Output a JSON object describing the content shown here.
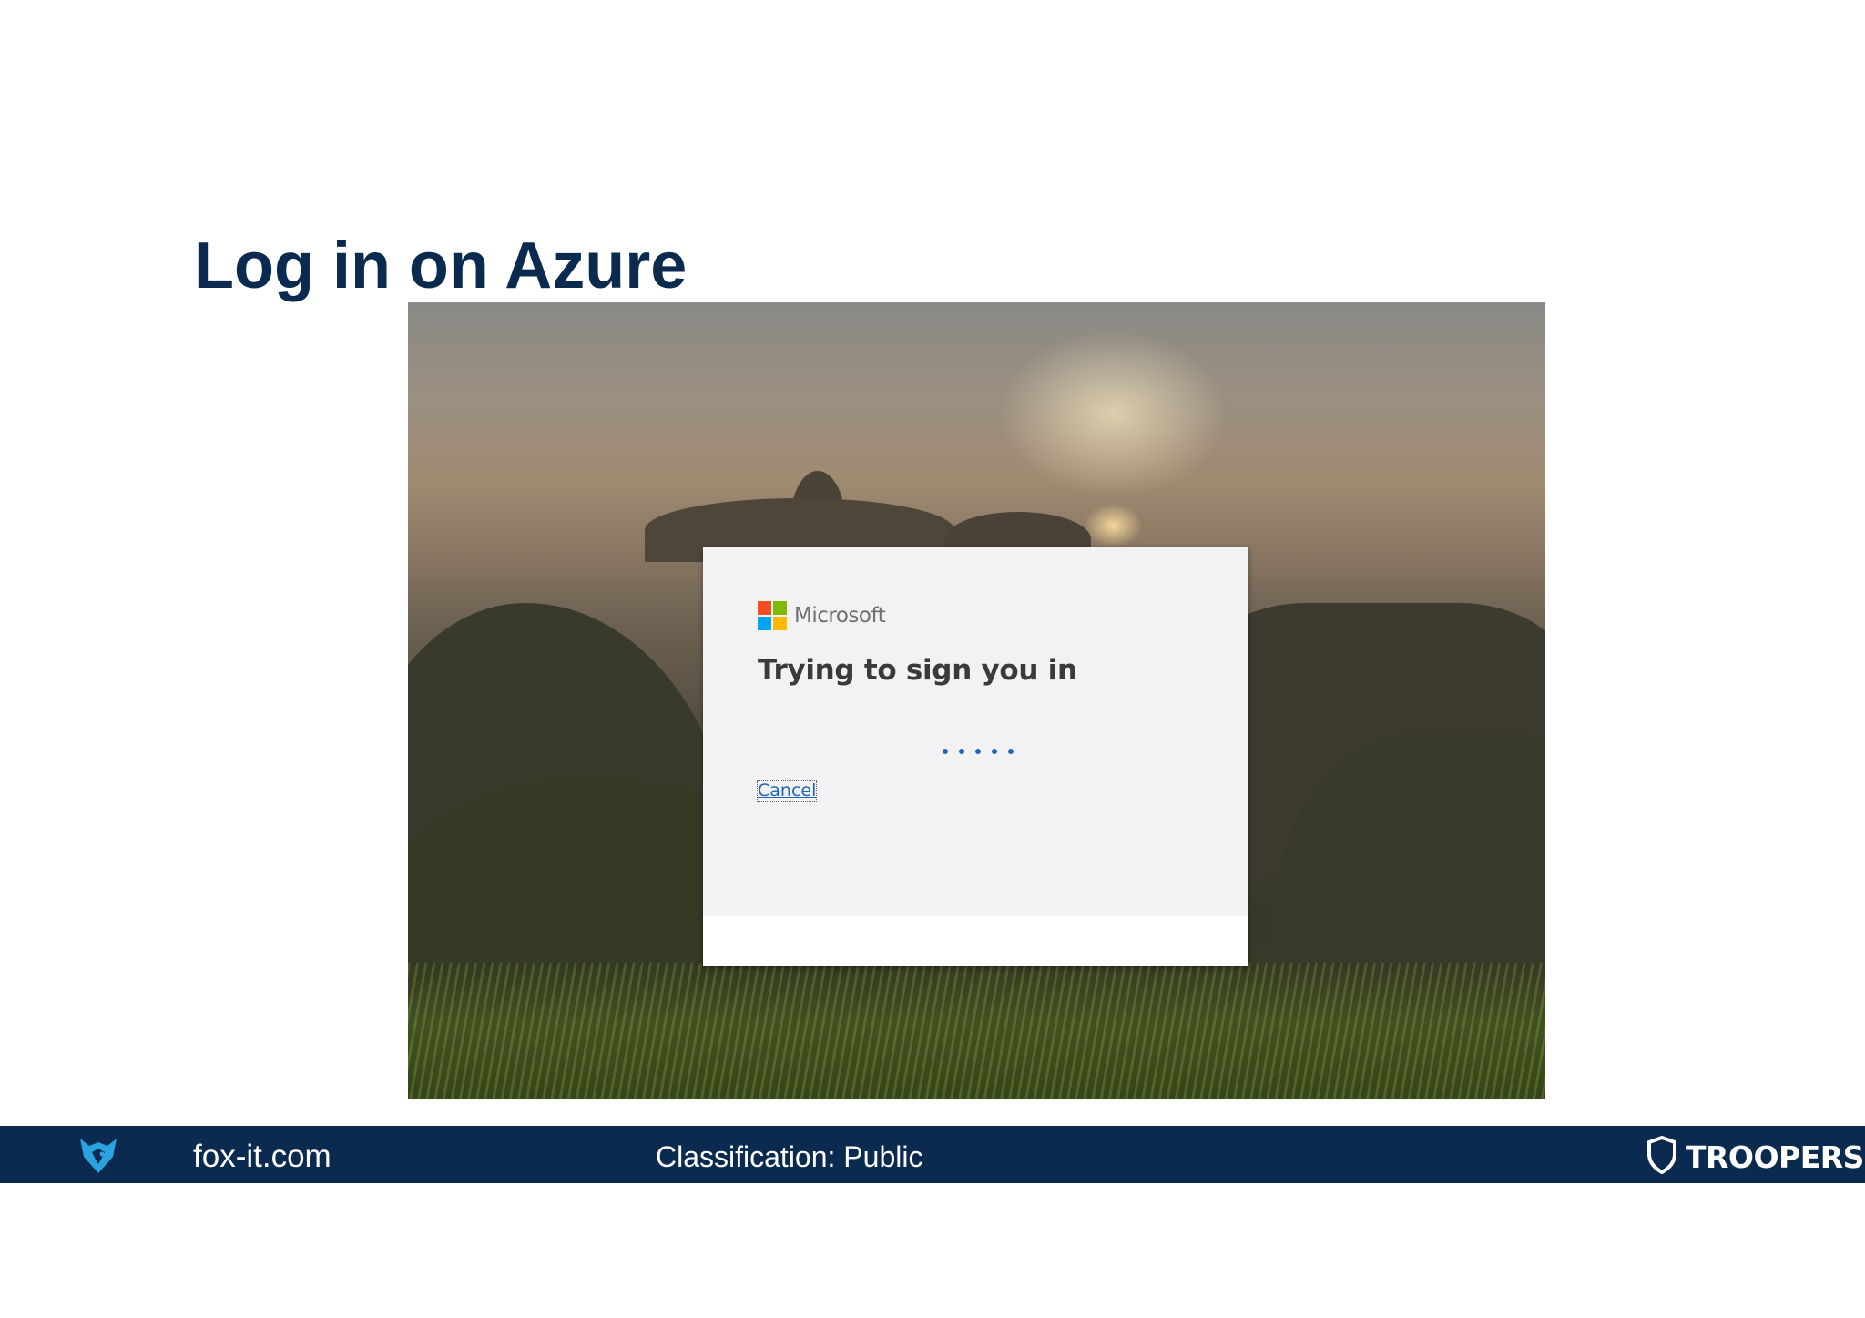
{
  "slide": {
    "title": "Log in on Azure"
  },
  "signin": {
    "brand": "Microsoft",
    "heading": "Trying to sign you in",
    "cancel_label": "Cancel",
    "accent_color": "#1f67b8",
    "brand_colors": [
      "#f25022",
      "#7fba00",
      "#00a4ef",
      "#ffb900"
    ],
    "progress_dots": 5
  },
  "footer": {
    "site": "fox-it.com",
    "classification": "Classification: Public",
    "event_logo": "TROOPERS",
    "background_color": "#0b2a4f"
  },
  "icons": {
    "fox": "fox-logo-icon",
    "shield": "troopers-shield-icon"
  }
}
